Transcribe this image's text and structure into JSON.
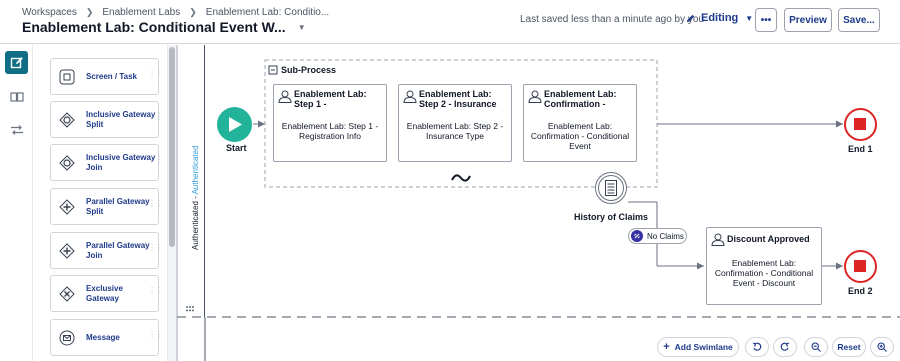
{
  "header": {
    "breadcrumbs": [
      "Workspaces",
      "Enablement Labs",
      "Enablement Lab: Conditio..."
    ],
    "title": "Enablement Lab: Conditional Event W...",
    "saved_text": "Last saved less than a minute ago by you",
    "mode": "Editing",
    "more_label": "•••",
    "preview_label": "Preview",
    "save_label": "Save..."
  },
  "palette": {
    "items": [
      {
        "label": "Screen / Task",
        "icon": "screen-task-icon"
      },
      {
        "label": "Inclusive Gateway Split",
        "icon": "inclusive-gateway-icon"
      },
      {
        "label": "Inclusive Gateway Join",
        "icon": "inclusive-gateway-icon"
      },
      {
        "label": "Parallel Gateway Split",
        "icon": "parallel-gateway-icon"
      },
      {
        "label": "Parallel Gateway Join",
        "icon": "parallel-gateway-icon"
      },
      {
        "label": "Exclusive Gateway",
        "icon": "exclusive-gateway-icon"
      },
      {
        "label": "Message",
        "icon": "message-icon"
      }
    ]
  },
  "swimlane": {
    "label_primary": "Authenticated - ",
    "label_secondary": "Authenticated"
  },
  "diagram": {
    "start_label": "Start",
    "subprocess_label": "Sub-Process",
    "tasks": [
      {
        "title": "Enablement Lab: Step 1 -",
        "body": "Enablement Lab: Step 1 - Registration Info"
      },
      {
        "title": "Enablement Lab: Step 2 - Insurance",
        "body": "Enablement Lab: Step 2 - Insurance Type"
      },
      {
        "title": "Enablement Lab: Confirmation -",
        "body": "Enablement Lab: Confirmation - Conditional Event"
      },
      {
        "title": "Discount Approved",
        "body": "Enablement Lab: Confirmation - Conditional Event - Discount"
      }
    ],
    "event_label": "History of Claims",
    "condition_label": "No Claims",
    "end1_label": "End 1",
    "end2_label": "End 2"
  },
  "toolbar": {
    "add_swimlane": "Add Swimlane",
    "reset": "Reset"
  },
  "colors": {
    "start": "#22b39b",
    "end": "#dc2626",
    "accent": "#1e3a8a",
    "rail_active": "#0f6e86"
  }
}
